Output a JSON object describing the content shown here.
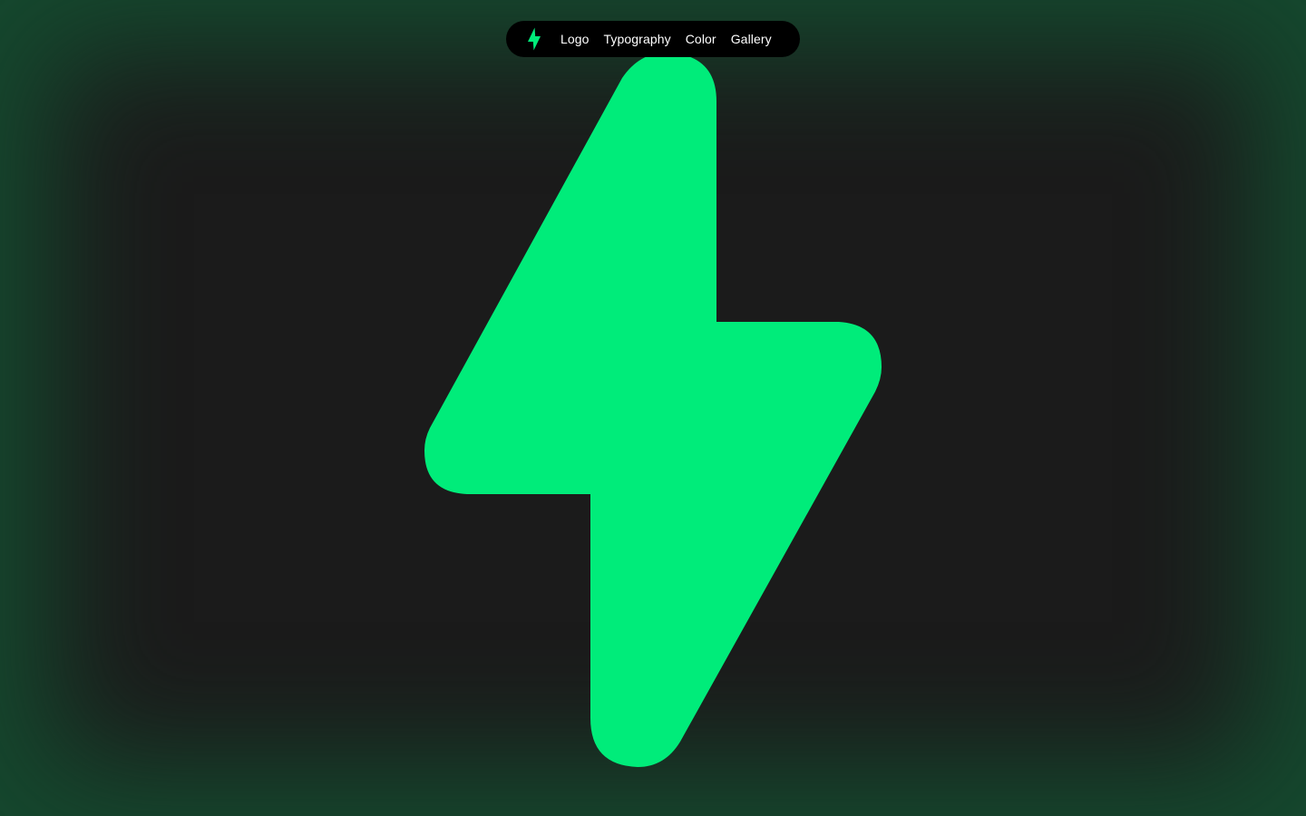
{
  "brand": {
    "accent_color": "#00ec7a",
    "background_color": "#1b1b1b",
    "frame_glow_color": "#15482e",
    "logo_icon": "lightning-bolt-icon"
  },
  "nav": {
    "items": [
      {
        "label": "Logo"
      },
      {
        "label": "Typography"
      },
      {
        "label": "Color"
      },
      {
        "label": "Gallery"
      }
    ]
  },
  "hero": {
    "icon": "lightning-bolt-icon"
  }
}
